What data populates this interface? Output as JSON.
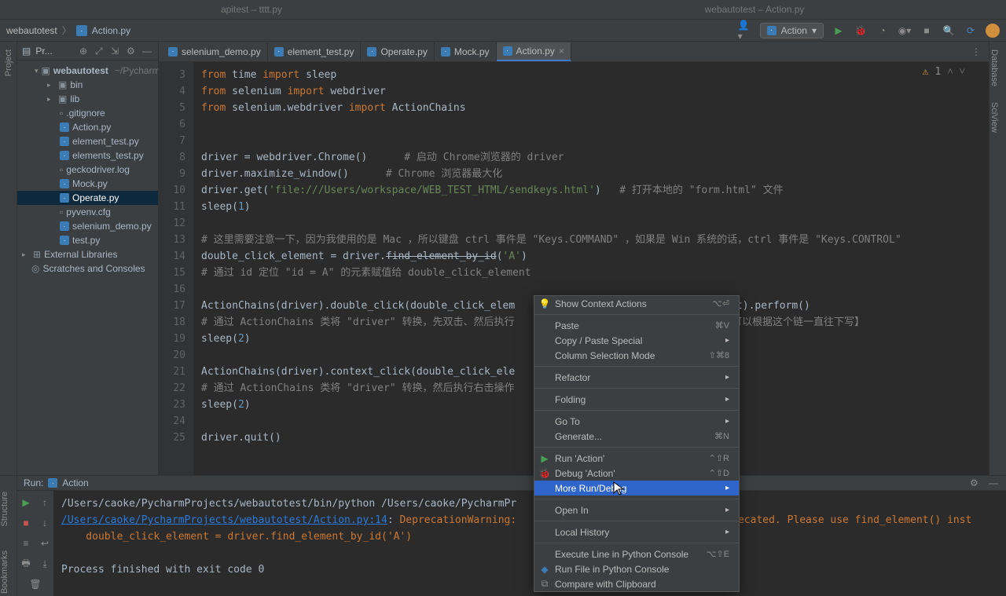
{
  "titlebar": {
    "left": "apitest – tttt.py",
    "right": "webautotest – Action.py"
  },
  "breadcrumb": {
    "project": "webautotest",
    "file": "Action.py"
  },
  "toolbar_right": {
    "config": "Action"
  },
  "project_panel": {
    "title": "Pr...",
    "root": "webautotest",
    "root_path": "~/PycharmPr",
    "items": [
      {
        "label": "bin",
        "type": "folder",
        "indent": 2
      },
      {
        "label": "lib",
        "type": "folder",
        "indent": 2
      },
      {
        "label": ".gitignore",
        "type": "file",
        "indent": 3
      },
      {
        "label": "Action.py",
        "type": "py",
        "indent": 3
      },
      {
        "label": "element_test.py",
        "type": "py",
        "indent": 3
      },
      {
        "label": "elements_test.py",
        "type": "py",
        "indent": 3
      },
      {
        "label": "geckodriver.log",
        "type": "file",
        "indent": 3
      },
      {
        "label": "Mock.py",
        "type": "py",
        "indent": 3
      },
      {
        "label": "Operate.py",
        "type": "py",
        "indent": 3,
        "selected": true
      },
      {
        "label": "pyvenv.cfg",
        "type": "file",
        "indent": 3
      },
      {
        "label": "selenium_demo.py",
        "type": "py",
        "indent": 3
      },
      {
        "label": "test.py",
        "type": "py",
        "indent": 3
      }
    ],
    "external": "External Libraries",
    "scratches": "Scratches and Consoles"
  },
  "tabs": [
    {
      "label": "selenium_demo.py"
    },
    {
      "label": "element_test.py"
    },
    {
      "label": "Operate.py"
    },
    {
      "label": "Mock.py"
    },
    {
      "label": "Action.py",
      "active": true
    }
  ],
  "editor": {
    "lines": [
      "3",
      "4",
      "5",
      "6",
      "7",
      "8",
      "9",
      "10",
      "11",
      "12",
      "13",
      "14",
      "15",
      "16",
      "17",
      "18",
      "19",
      "20",
      "21",
      "22",
      "23",
      "24",
      "25"
    ],
    "status_warn": "1"
  },
  "run": {
    "label": "Run:",
    "name": "Action",
    "path1": "/Users/caoke/PycharmProjects/webautotest/bin/python /Users/caoke/PycharmPr",
    "link": "/Users/caoke/PycharmProjects/webautotest/Action.py:14",
    "warn1": "DeprecationWarning:",
    "warn_tail": "precated. Please use find_element() inst",
    "line3": "    double_click_element = driver.find_element_by_id('A')",
    "finished": "Process finished with exit code 0"
  },
  "context_menu": {
    "items": [
      {
        "label": "Show Context Actions",
        "shortcut": "⌥⏎",
        "icon": "bulb"
      },
      {
        "sep": true
      },
      {
        "label": "Paste",
        "shortcut": "⌘V"
      },
      {
        "label": "Copy / Paste Special",
        "arrow": true
      },
      {
        "label": "Column Selection Mode",
        "shortcut": "⇧⌘8"
      },
      {
        "sep": true
      },
      {
        "label": "Refactor",
        "arrow": true
      },
      {
        "sep": true
      },
      {
        "label": "Folding",
        "arrow": true
      },
      {
        "sep": true
      },
      {
        "label": "Go To",
        "arrow": true
      },
      {
        "label": "Generate...",
        "shortcut": "⌘N"
      },
      {
        "sep": true
      },
      {
        "label": "Run 'Action'",
        "shortcut": "⌃⇧R",
        "icon": "run"
      },
      {
        "label": "Debug 'Action'",
        "shortcut": "⌃⇧D",
        "icon": "debug"
      },
      {
        "label": "More Run/Debug",
        "arrow": true,
        "highlighted": true
      },
      {
        "sep": true
      },
      {
        "label": "Open In",
        "arrow": true
      },
      {
        "sep": true
      },
      {
        "label": "Local History",
        "arrow": true
      },
      {
        "sep": true
      },
      {
        "label": "Execute Line in Python Console",
        "shortcut": "⌥⇧E"
      },
      {
        "label": "Run File in Python Console",
        "icon": "py"
      },
      {
        "label": "Compare with Clipboard",
        "icon": "compare"
      }
    ]
  },
  "side_labels": {
    "project": "Project",
    "structure": "Structure",
    "bookmarks": "Bookmarks",
    "database": "Database",
    "sciview": "SciView"
  }
}
